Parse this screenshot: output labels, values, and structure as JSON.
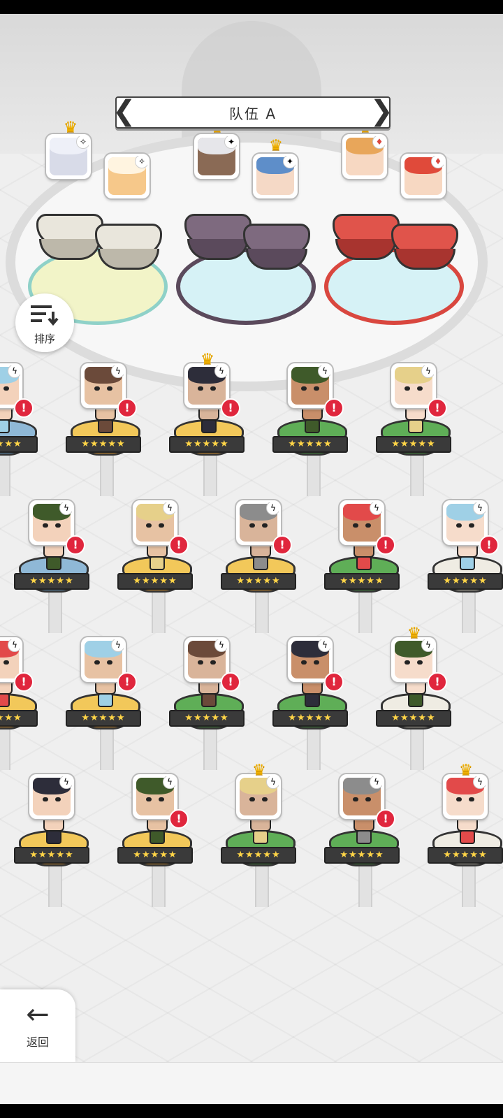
{
  "team": {
    "title": "队伍 A",
    "prev_icon": "chevron-left-icon",
    "next_icon": "chevron-right-icon"
  },
  "sort_button": {
    "label": "排序",
    "icon": "sort-icon"
  },
  "back_button": {
    "label": "返回",
    "icon": "arrow-left-icon"
  },
  "colors": {
    "light_element": "#f2f4c8",
    "dark_element": "#5b4a5c",
    "fire_element": "#d9473f",
    "alert": "#e0263d",
    "crown": "#f4b400",
    "gold_stand": "#f2c85a",
    "green_stand": "#4f9a4a",
    "blue_stand": "#7aa9c9",
    "white_stand": "#e9e6dc"
  },
  "selected_team": [
    {
      "element": "light",
      "has_crown": true
    },
    {
      "element": "light",
      "has_crown": false
    },
    {
      "element": "dark",
      "has_crown": true
    },
    {
      "element": "dark",
      "has_crown": true
    },
    {
      "element": "fire",
      "has_crown": true
    },
    {
      "element": "fire",
      "has_crown": false
    }
  ],
  "roster_rows": [
    [
      {
        "stand": "blue",
        "stars": "★★★★★",
        "alert": "!",
        "crown": false
      },
      {
        "stand": "gold",
        "stars": "★★★★★",
        "alert": "!",
        "crown": false
      },
      {
        "stand": "gold",
        "stars": "★★★★★",
        "alert": "!",
        "crown": true
      },
      {
        "stand": "green",
        "stars": "★★★★★",
        "alert": "!",
        "crown": false
      },
      {
        "stand": "green",
        "stars": "★★★★★",
        "alert": "!",
        "crown": false
      }
    ],
    [
      {
        "stand": "blue",
        "stars": "★★★★★",
        "alert": "!",
        "crown": false
      },
      {
        "stand": "gold",
        "stars": "★★★★★",
        "alert": "!",
        "crown": false
      },
      {
        "stand": "gold",
        "stars": "★★★★★",
        "alert": "!",
        "crown": false
      },
      {
        "stand": "green",
        "stars": "★★★★★",
        "alert": "!",
        "crown": false
      },
      {
        "stand": "white",
        "stars": "★★★★★",
        "alert": "!",
        "crown": false
      }
    ],
    [
      {
        "stand": "gold",
        "stars": "★★★★★",
        "alert": "!",
        "crown": false
      },
      {
        "stand": "gold",
        "stars": "★★★★★",
        "alert": "!",
        "crown": false
      },
      {
        "stand": "green",
        "stars": "★★★★★",
        "alert": "!",
        "crown": false
      },
      {
        "stand": "green",
        "stars": "★★★★★",
        "alert": "!",
        "crown": false
      },
      {
        "stand": "white",
        "stars": "★★★★★",
        "alert": "!",
        "crown": true
      }
    ],
    [
      {
        "stand": "gold",
        "stars": "★★★★★",
        "alert": "",
        "crown": false
      },
      {
        "stand": "gold",
        "stars": "★★★★★",
        "alert": "!",
        "crown": false
      },
      {
        "stand": "green",
        "stars": "★★★★★",
        "alert": "",
        "crown": true
      },
      {
        "stand": "green",
        "stars": "★★★★★",
        "alert": "!",
        "crown": false
      },
      {
        "stand": "white",
        "stars": "★★★★★",
        "alert": "",
        "crown": true
      }
    ]
  ]
}
